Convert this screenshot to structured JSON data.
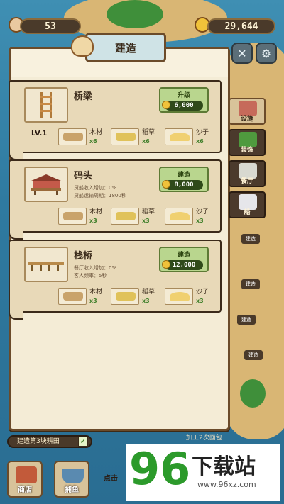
{
  "top": {
    "shells": "53",
    "coins": "29,644"
  },
  "panel": {
    "title": "建造"
  },
  "cards": [
    {
      "name": "桥梁",
      "level": "LV.1",
      "desc": [],
      "action": "升级",
      "cost": "6,000",
      "materials": [
        {
          "name": "木材",
          "qty": "x6"
        },
        {
          "name": "稻草",
          "qty": "x6"
        },
        {
          "name": "沙子",
          "qty": "x6"
        }
      ]
    },
    {
      "name": "码头",
      "level": "",
      "desc": [
        "货船收入增加：0%",
        "货船运输周期：1800秒"
      ],
      "action": "建造",
      "cost": "8,000",
      "materials": [
        {
          "name": "木材",
          "qty": "x3"
        },
        {
          "name": "稻草",
          "qty": "x3"
        },
        {
          "name": "沙子",
          "qty": "x3"
        }
      ]
    },
    {
      "name": "栈桥",
      "level": "",
      "desc": [
        "餐厅收入增加：0%",
        "客人频率：5秒"
      ],
      "action": "建造",
      "cost": "12,000",
      "materials": [
        {
          "name": "木材",
          "qty": "x3"
        },
        {
          "name": "稻草",
          "qty": "x3"
        },
        {
          "name": "沙子",
          "qty": "x3"
        }
      ]
    }
  ],
  "side_tabs": [
    "设施",
    "装饰",
    "餐厅",
    "船"
  ],
  "map_markers": [
    "建造",
    "建造",
    "建造",
    "建造"
  ],
  "bottom": {
    "task": "建造第3块耕田",
    "hint_right": "加工2次面包",
    "hint_center": "点击",
    "shop": "商店",
    "fish": "捕鱼"
  },
  "watermark": {
    "number": "96",
    "text": "下载站",
    "url": "www.96xz.com"
  },
  "colors": {
    "accent_green": "#b9d68e",
    "panel": "#f4ecd6",
    "border": "#3b2a1a"
  },
  "icons": {
    "settings": "gear-icon",
    "map": "map-icon",
    "wood": "wood-log-icon",
    "straw": "straw-bundle-icon",
    "sand": "sand-pile-icon"
  }
}
